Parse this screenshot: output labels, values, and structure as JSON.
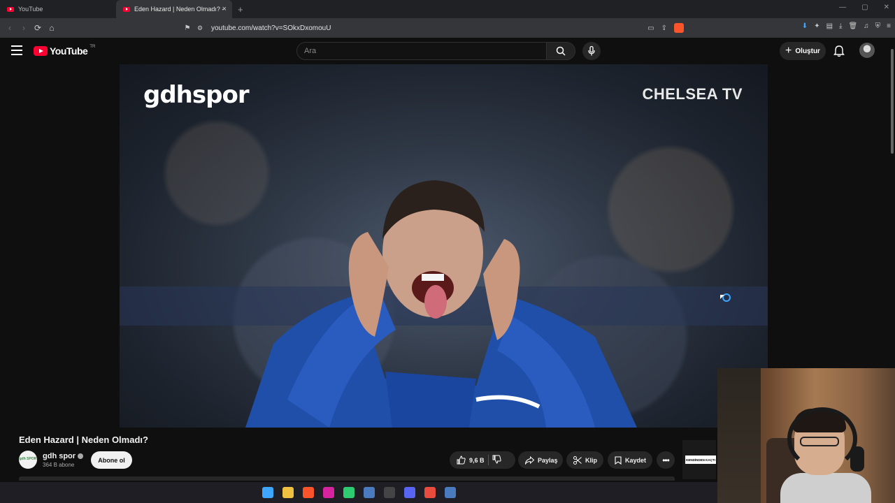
{
  "browser": {
    "tabs": [
      {
        "title": "YouTube"
      },
      {
        "title": "Eden Hazard | Neden Olmadı? -",
        "close": "×"
      }
    ],
    "new_tab": "+",
    "url": "youtube.com/watch?v=SOkxDxomouU",
    "window_controls": [
      "—",
      "▢",
      "✕"
    ]
  },
  "masthead": {
    "logo_text": "YouTube",
    "country_code": "TR",
    "search_placeholder": "Ara",
    "create_label": "Oluştur"
  },
  "player": {
    "watermark_left": "gdhspor",
    "watermark_right": "CHELSEA TV"
  },
  "video": {
    "title": "Eden Hazard | Neden Olmadı?",
    "channel_name": "gdh spor",
    "channel_avatar_text": "gdh SPOR",
    "subscribers": "364 B abone",
    "subscribe_label": "Abone ol",
    "like_count": "9,6 B",
    "share_label": "Paylaş",
    "clip_label": "Klip",
    "save_label": "Kaydet",
    "more_label": "•••"
  },
  "next_thumbnail": {
    "text": "KENDİNDEN KAÇTI"
  },
  "taskbar": {
    "apps": [
      "windows-start",
      "file-explorer",
      "brave-browser",
      "instagram",
      "app-grid",
      "steam",
      "terminal",
      "discord",
      "app-recorder",
      "steam-2"
    ],
    "colors": [
      "#3ea6ff",
      "#f0c040",
      "#fb542b",
      "#d6249f",
      "#2ecc71",
      "#4a7bbf",
      "#444444",
      "#5865f2",
      "#e74c3c",
      "#4a7bbf"
    ]
  }
}
